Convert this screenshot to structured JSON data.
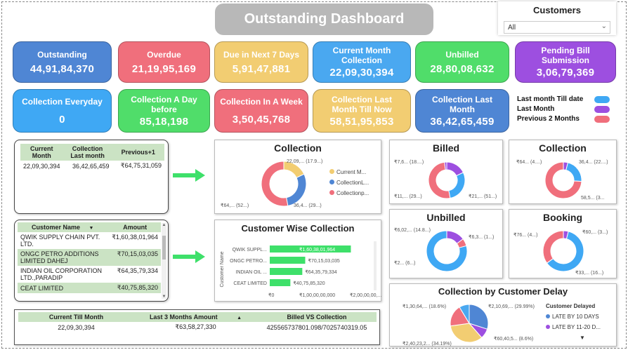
{
  "title": "Outstanding Dashboard",
  "slicer": {
    "label": "Customers",
    "value": "All"
  },
  "kpis": [
    {
      "label": "Outstanding",
      "value": "44,91,84,370",
      "color": "#4f86d4"
    },
    {
      "label": "Overdue",
      "value": "21,19,95,169",
      "color": "#f06f7c"
    },
    {
      "label": "Due in Next 7 Days",
      "value": "5,91,47,881",
      "color": "#f2cd72"
    },
    {
      "label": "Current Month Collection",
      "value": "22,09,30,394",
      "color": "#4aa8f0"
    },
    {
      "label": "Unbilled",
      "value": "28,80,08,632",
      "color": "#50dd6a"
    },
    {
      "label": "Pending Bill Submission",
      "value": "3,06,79,369",
      "color": "#9d4fe0"
    },
    {
      "label": "Collection Everyday",
      "value": "0",
      "color": "#3fa8f4"
    },
    {
      "label": "Collection A Day before",
      "value": "85,18,198",
      "color": "#50dd6a"
    },
    {
      "label": "Collection In A Week",
      "value": "3,50,45,768",
      "color": "#f06f7c"
    },
    {
      "label": "Collection Last Month Till Now",
      "value": "58,51,95,853",
      "color": "#f2cd72"
    },
    {
      "label": "Collection Last Month",
      "value": "36,42,65,459",
      "color": "#4f86d4"
    }
  ],
  "period_legend": [
    {
      "label": "Last month Till date",
      "color": "#3fa8f4"
    },
    {
      "label": "Last Month",
      "color": "#9d4fe0"
    },
    {
      "label": "Previous 2 Months",
      "color": "#f06f7c"
    }
  ],
  "summary_table": {
    "headers": [
      "Current Month",
      "Collection Last month",
      "Previous+1"
    ],
    "row": [
      "22,09,30,394",
      "36,42,65,459",
      "₹64,75,31,059"
    ]
  },
  "customer_table": {
    "headers": [
      "Customer Name",
      "Amount"
    ],
    "rows": [
      [
        "QWIK SUPPLY CHAIN PVT. LTD.",
        "₹1,60,38,01,964"
      ],
      [
        "ONGC PETRO ADDITIONS LIMITED DAHEJ",
        "₹70,15,03,035"
      ],
      [
        "INDIAN OIL CORPORATION LTD.,PARADIP",
        "₹64,35,79,334"
      ],
      [
        "CEAT LIMITED",
        "₹40,75,85,320"
      ]
    ]
  },
  "bottom_table": {
    "headers": [
      "Current Till Month",
      "Last 3 Months Amount",
      "Billed VS Collection"
    ],
    "row": [
      "22,09,30,394",
      "₹63,58,27,330",
      "425565737801.098/7025740319.05"
    ]
  },
  "collection_donut": {
    "title": "Collection",
    "labels": [
      "22,09,... (17.9...)",
      "36,4... (29...)",
      "₹64,... (52...)"
    ],
    "legend": [
      "Current M...",
      "CollectionL...",
      "Collectionp..."
    ],
    "colors": [
      "#f2cd72",
      "#4f86d4",
      "#f06f7c"
    ]
  },
  "customer_chart": {
    "title": "Customer Wise Collection",
    "y_axis_label": "Customer Name",
    "categories": [
      "QWIK SUPPL...",
      "ONGC PETRO...",
      "INDIAN OIL ...",
      "CEAT LIMITED"
    ],
    "value_labels": [
      "₹1,60,38,01,964",
      "₹70,15,03,035",
      "₹64,35,79,334",
      "₹40,75,85,320"
    ],
    "ticks": [
      "₹0",
      "₹1,00,00,00,000",
      "₹2,00,00,00,..."
    ]
  },
  "chart_data": [
    {
      "type": "pie",
      "title": "Collection",
      "categories": [
        "Current Month",
        "Collection Last month",
        "Collection previous"
      ],
      "values": [
        17.9,
        29.2,
        52.9
      ]
    },
    {
      "type": "bar",
      "title": "Customer Wise Collection",
      "categories": [
        "QWIK SUPPL...",
        "ONGC PETRO...",
        "INDIAN OIL ...",
        "CEAT LIMITED"
      ],
      "values": [
        1603801964,
        701503035,
        643579334,
        407585320
      ],
      "xlim": [
        0,
        2000000000
      ]
    },
    {
      "type": "pie",
      "title": "Billed",
      "values": [
        18,
        29,
        51,
        2
      ]
    },
    {
      "type": "pie",
      "title": "Collection",
      "values": [
        4,
        22,
        74
      ]
    },
    {
      "type": "pie",
      "title": "Unbilled",
      "values": [
        14.8,
        6,
        79.2
      ]
    },
    {
      "type": "pie",
      "title": "Booking",
      "values": [
        4,
        61,
        35
      ]
    },
    {
      "type": "pie",
      "title": "Collection by Customer Delay",
      "values": [
        29.99,
        8.6,
        34.19,
        18.6,
        8.62
      ]
    }
  ],
  "billed": {
    "title": "Billed",
    "labels": [
      "₹7,6... (18....)",
      "₹11,... (29...)",
      "₹21,... (51...)"
    ]
  },
  "collection2": {
    "title": "Collection",
    "labels": [
      "₹64... (4....)",
      "36,4... (22....)",
      "58,5... (3..."
    ]
  },
  "unbilled": {
    "title": "Unbilled",
    "labels": [
      "₹6,02,... (14.8...)",
      "₹6,3... (1...)",
      "₹2... (6...)"
    ]
  },
  "booking": {
    "title": "Booking",
    "labels": [
      "₹76... (4...)",
      "₹60,... (3...)",
      "₹33,... (16...)"
    ]
  },
  "delay": {
    "title": "Collection by Customer Delay",
    "labels": [
      "₹1,30,64,... (18.6%)",
      "₹2,10,69,... (29.99%)",
      "₹60,40,5... (8.6%)",
      "₹2,40,23,2... (34.19%)"
    ],
    "legend_title": "Customer Delayed",
    "legend": [
      {
        "label": "LATE BY 10 DAYS",
        "color": "#4f86d4"
      },
      {
        "label": "LATE BY 11-20 D...",
        "color": "#9d4fe0"
      }
    ]
  }
}
